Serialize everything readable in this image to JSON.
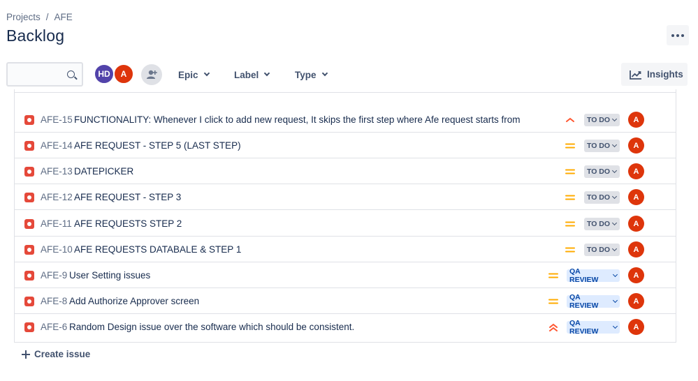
{
  "breadcrumb": {
    "projects": "Projects",
    "separator": "/",
    "project": "AFE"
  },
  "page": {
    "title": "Backlog"
  },
  "toolbar": {
    "search_value": "",
    "avatars": [
      {
        "initials": "HD",
        "color": "#5243aa"
      },
      {
        "initials": "A",
        "color": "#de350b"
      }
    ],
    "filters": {
      "epic": "Epic",
      "label": "Label",
      "type": "Type"
    },
    "insights_label": "Insights"
  },
  "issues": [
    {
      "key": "AFE-15",
      "summary": "FUNCTIONALITY: Whenever I click to add new request, It skips the first step where Afe request starts from",
      "priority": "high",
      "status": "TO DO",
      "assignee": "A"
    },
    {
      "key": "AFE-14",
      "summary": "AFE REQUEST - STEP 5 (LAST STEP)",
      "priority": "medium",
      "status": "TO DO",
      "assignee": "A"
    },
    {
      "key": "AFE-13",
      "summary": "DATEPICKER",
      "priority": "medium",
      "status": "TO DO",
      "assignee": "A"
    },
    {
      "key": "AFE-12",
      "summary": "AFE REQUEST - STEP 3",
      "priority": "medium",
      "status": "TO DO",
      "assignee": "A"
    },
    {
      "key": "AFE-11",
      "summary": "AFE REQUESTS STEP 2",
      "priority": "medium",
      "status": "TO DO",
      "assignee": "A"
    },
    {
      "key": "AFE-10",
      "summary": "AFE REQUESTS DATABALE & STEP 1",
      "priority": "medium",
      "status": "TO DO",
      "assignee": "A"
    },
    {
      "key": "AFE-9",
      "summary": "User Setting issues",
      "priority": "medium",
      "status": "QA REVIEW",
      "assignee": "A"
    },
    {
      "key": "AFE-8",
      "summary": "Add Authorize Approver screen",
      "priority": "medium",
      "status": "QA REVIEW",
      "assignee": "A"
    },
    {
      "key": "AFE-6",
      "summary": "Random Design issue over the software which should be consistent.",
      "priority": "highest",
      "status": "QA REVIEW",
      "assignee": "A"
    }
  ],
  "create_issue_label": "Create issue",
  "colors": {
    "bug": "#e5493a",
    "medium": "#ffab00",
    "high": "#ff5630",
    "todo_bg": "#dfe1e6",
    "qa_bg": "#deebff",
    "qa_text": "#0747a6"
  }
}
